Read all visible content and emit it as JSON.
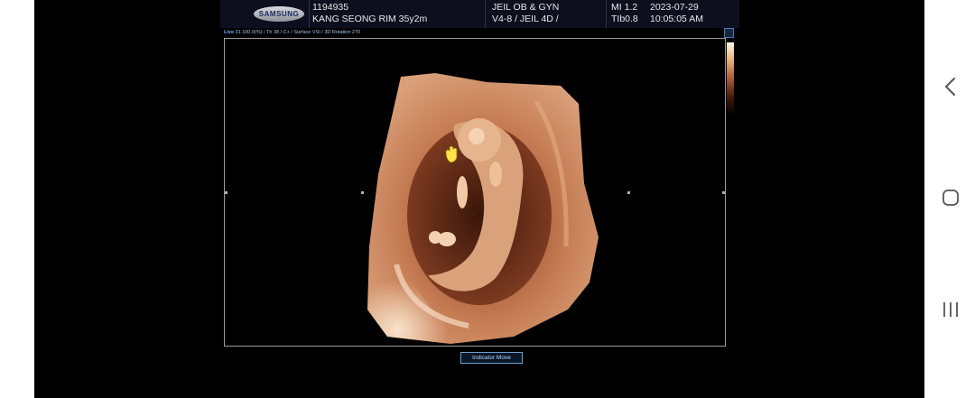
{
  "header": {
    "brand": "SAMSUNG",
    "patient_id": "1194935",
    "patient_name": "KANG SEONG RIM 35y2m",
    "hospital": "JEIL OB & GYN",
    "probe": "V4-8 / JEIL 4D /",
    "mi": "MI  1.2",
    "tib": "TIb0.8",
    "date": "2023-07-29",
    "time": "10:05:05 AM"
  },
  "status_bar": {
    "mode": "Live",
    "text": "31 100.0(%) / Th 38 / C+ / Surface VSI / 3D Rotation 270"
  },
  "viewer": {
    "image_label": "3D rendered fetal ultrasound"
  },
  "buttons": {
    "indicator_move": "Indicator Move"
  },
  "nav": {
    "back": "back-icon",
    "home": "home-icon",
    "recents": "recents-icon"
  },
  "colors": {
    "header_bg": "#0d0f1e",
    "tissue": "#c9825a",
    "highlight": "#f3d2b3"
  }
}
